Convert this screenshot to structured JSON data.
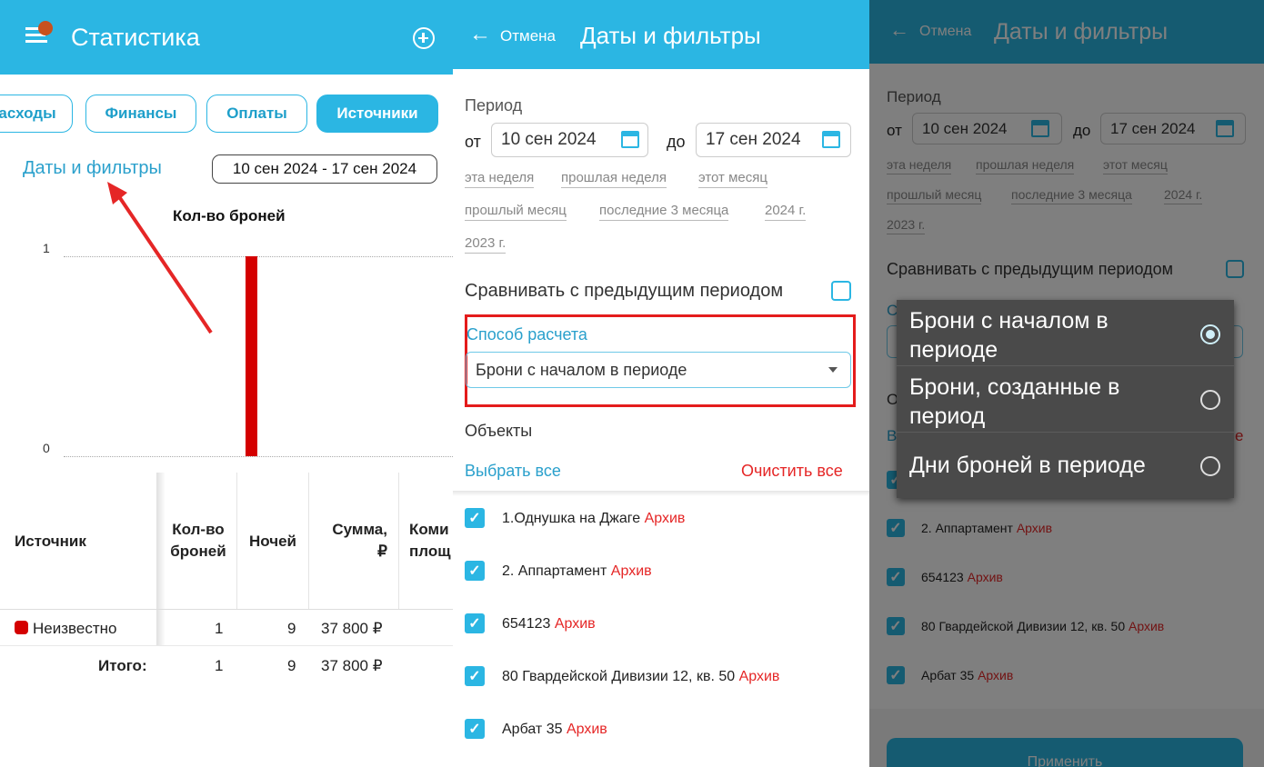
{
  "panel1": {
    "title": "Статистика",
    "menu_icon": "hamburger-icon",
    "add_icon": "plus-circle-icon",
    "tabs": [
      "асходы",
      "Финансы",
      "Оплаты",
      "Источники"
    ],
    "active_tab_index": 3,
    "filters_link": "Даты и фильтры",
    "date_range": "10 сен 2024 - 17 сен 2024",
    "chart_title": "Кол-во броней",
    "table": {
      "headers": [
        "Источник",
        "Кол-во\nброней",
        "Ночей",
        "Сумма,\n₽",
        "Коми\nплощ"
      ],
      "rows": [
        {
          "source": "Неизвестно",
          "bookings": "1",
          "nights": "9",
          "sum": "37 800 ₽"
        }
      ],
      "total": {
        "label": "Итого:",
        "bookings": "1",
        "nights": "9",
        "sum": "37 800 ₽"
      }
    },
    "colors": {
      "accent": "#2bb6e3",
      "bar": "#d40000",
      "arrow": "#e52626"
    }
  },
  "chart_data": {
    "type": "bar",
    "categories": [
      "Неизвестно"
    ],
    "values": [
      1
    ],
    "title": "Кол-во броней",
    "xlabel": "",
    "ylabel": "",
    "ylim": [
      0,
      1
    ],
    "yticks": [
      "0",
      "1"
    ],
    "grid": true
  },
  "panel2": {
    "back_label": "Отмена",
    "title": "Даты и фильтры",
    "period_label": "Период",
    "from_label": "от",
    "from_value": "10 сен 2024",
    "to_label": "до",
    "to_value": "17 сен 2024",
    "presets": [
      "эта неделя",
      "прошлая неделя",
      "этот месяц",
      "прошлый месяц",
      "последние 3 месяца",
      "2024 г.",
      "2023 г."
    ],
    "compare_label": "Сравнивать с предыдущим периодом",
    "calc_label": "Способ расчета",
    "calc_value": "Брони с началом в периоде",
    "objects_label": "Объекты",
    "select_all": "Выбрать все",
    "clear_all": "Очистить все",
    "objects": [
      {
        "name": "1.Однушка на Джаге",
        "tag": "Архив"
      },
      {
        "name": "2. Аппартамент",
        "tag": "Архив"
      },
      {
        "name": "654123",
        "tag": "Архив"
      },
      {
        "name": "80 Гвардейской Дивизии 12, кв. 50",
        "tag": "Архив"
      },
      {
        "name": "Арбат 35",
        "tag": "Архив"
      }
    ]
  },
  "panel3": {
    "back_label": "Отмена",
    "title": "Даты и фильтры",
    "period_label": "Период",
    "from_label": "от",
    "from_value": "10 сен 2024",
    "to_label": "до",
    "to_value": "17 сен 2024",
    "presets": [
      "эта неделя",
      "прошлая неделя",
      "этот месяц",
      "прошлый месяц",
      "последние 3 месяца",
      "2024 г.",
      "2023 г."
    ],
    "compare_label": "Сравнивать с предыдущим периодом",
    "partial_c": "С",
    "partial_o": "О",
    "partial_b": "В",
    "partial_e": "е",
    "objects": [
      {
        "name": "2. Аппартамент",
        "tag": "Архив"
      },
      {
        "name": "654123",
        "tag": "Архив"
      },
      {
        "name": "80 Гвардейской Дивизии 12, кв. 50",
        "tag": "Архив"
      },
      {
        "name": "Арбат 35",
        "tag": "Архив"
      }
    ],
    "apply_label": "Применить",
    "options": [
      {
        "line1": "Брони с началом в",
        "line2": "периоде",
        "selected": true
      },
      {
        "line1": "Брони, созданные в",
        "line2": "период",
        "selected": false
      },
      {
        "line1": "Дни броней в периоде",
        "line2": "",
        "selected": false
      }
    ]
  }
}
